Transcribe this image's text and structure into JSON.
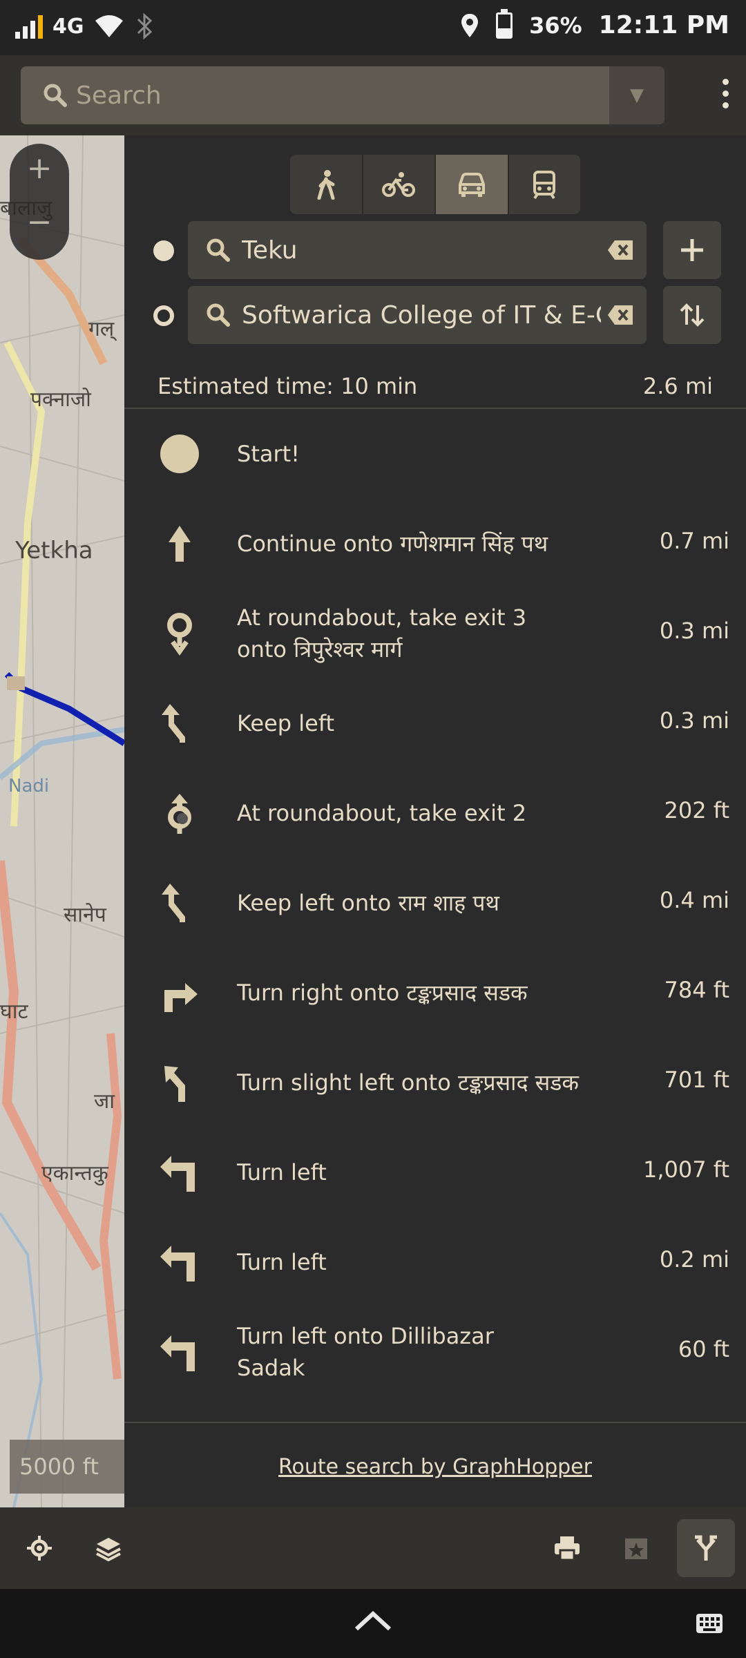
{
  "status_bar": {
    "network": "4G",
    "battery": "36%",
    "time": "12:11 PM"
  },
  "search": {
    "placeholder": "Search"
  },
  "map": {
    "scale": "5000 ft",
    "labels": [
      "बालाजु",
      "गल्",
      "पक्नाजोल",
      "Yetkha",
      "Nadi",
      "सानेप",
      "घाट",
      "जा",
      "एकान्तकु"
    ]
  },
  "routing": {
    "modes": [
      "walk",
      "bicycle",
      "car",
      "transit"
    ],
    "active_mode": "car",
    "start": "Teku",
    "destination": "Softwarica College of IT & E-Commerce",
    "estimated_time": "Estimated time: 10 min",
    "total_distance": "2.6 mi",
    "steps": [
      {
        "icon": "start-dot-icon",
        "text": "Start!",
        "distance": ""
      },
      {
        "icon": "arrow-straight-icon",
        "text": "Continue onto गणेशमान सिंह पथ",
        "distance": "0.7 mi"
      },
      {
        "icon": "roundabout-exit-icon",
        "text": "At roundabout, take exit 3 onto त्रिपुरेश्वर मार्ग",
        "distance": "0.3 mi"
      },
      {
        "icon": "keep-left-icon",
        "text": "Keep left",
        "distance": "0.3 mi"
      },
      {
        "icon": "roundabout-icon",
        "text": "At roundabout, take exit 2",
        "distance": "202 ft"
      },
      {
        "icon": "keep-left-icon",
        "text": "Keep left onto राम शाह पथ",
        "distance": "0.4 mi"
      },
      {
        "icon": "turn-right-icon",
        "text": "Turn right onto टङ्कप्रसाद सडक",
        "distance": "784 ft"
      },
      {
        "icon": "slight-left-icon",
        "text": "Turn slight left onto टङ्कप्रसाद सडक",
        "distance": "701 ft"
      },
      {
        "icon": "turn-left-icon",
        "text": "Turn left",
        "distance": "1,007 ft"
      },
      {
        "icon": "turn-left-icon",
        "text": "Turn left",
        "distance": "0.2 mi"
      },
      {
        "icon": "turn-left-icon",
        "text": "Turn left onto Dillibazar Sadak",
        "distance": "60 ft"
      }
    ],
    "credit": "Route search by GraphHopper"
  },
  "colors": {
    "accent": "#d9ccaa",
    "panel_bg": "#2b2b2b",
    "route_line": "#1020b0"
  }
}
